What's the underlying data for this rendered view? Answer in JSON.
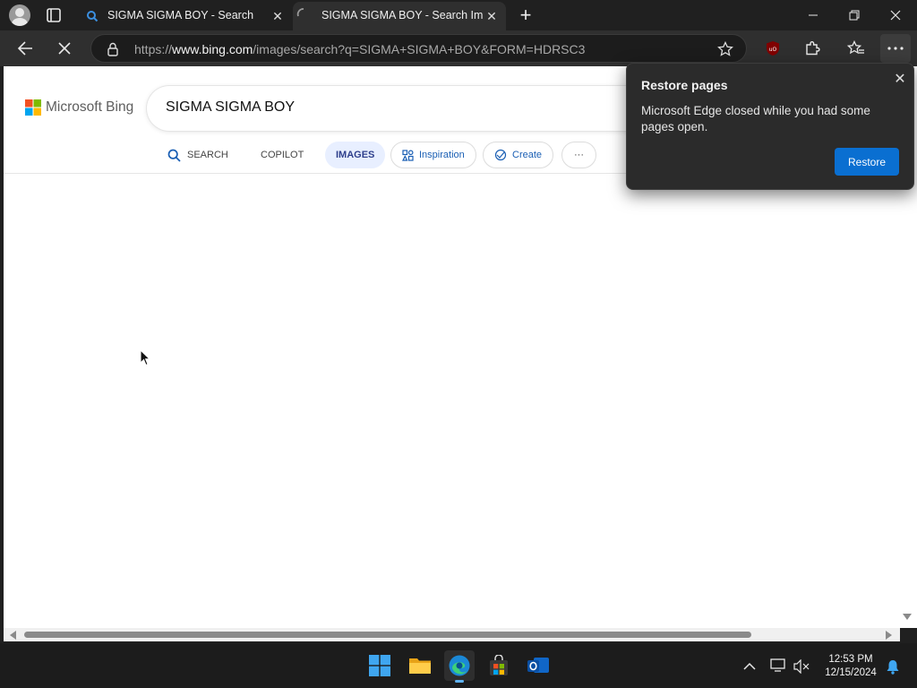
{
  "browser": {
    "tabs": [
      {
        "title": "SIGMA SIGMA BOY - Search",
        "active": false
      },
      {
        "title": "SIGMA SIGMA BOY - Search Imag",
        "active": true
      }
    ],
    "url_prefix": "https://",
    "url_host": "www.bing.com",
    "url_path": "/images/search?q=SIGMA+SIGMA+BOY&FORM=HDRSC3"
  },
  "bing": {
    "logo_text": "Microsoft Bing",
    "query": "SIGMA SIGMA BOY",
    "nav": {
      "search": "SEARCH",
      "copilot": "COPILOT",
      "images": "IMAGES",
      "inspiration": "Inspiration",
      "create": "Create",
      "more": "···"
    }
  },
  "restore_popup": {
    "title": "Restore pages",
    "message": "Microsoft Edge closed while you had some pages open.",
    "button": "Restore"
  },
  "taskbar": {
    "time": "12:53 PM",
    "date": "12/15/2024"
  },
  "colors": {
    "accent": "#0a6fd1",
    "chrome_dark": "#202020",
    "tab_active": "#2f2f2f"
  }
}
